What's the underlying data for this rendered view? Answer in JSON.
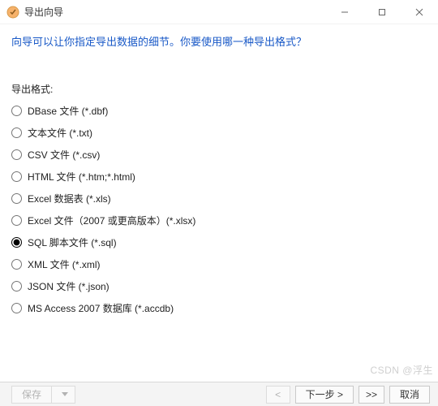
{
  "window": {
    "title": "导出向导",
    "minimize": "–",
    "maximize": "☐",
    "close": "×"
  },
  "instruction": "向导可以让你指定导出数据的细节。你要使用哪一种导出格式？",
  "section_label": "导出格式:",
  "selected_index": 6,
  "formats": [
    {
      "label": "DBase 文件 (*.dbf)"
    },
    {
      "label": "文本文件 (*.txt)"
    },
    {
      "label": "CSV 文件 (*.csv)"
    },
    {
      "label": "HTML 文件 (*.htm;*.html)"
    },
    {
      "label": "Excel 数据表 (*.xls)"
    },
    {
      "label": "Excel 文件（2007 或更高版本）(*.xlsx)"
    },
    {
      "label": "SQL 脚本文件 (*.sql)"
    },
    {
      "label": "XML 文件 (*.xml)"
    },
    {
      "label": "JSON 文件 (*.json)"
    },
    {
      "label": "MS Access 2007 数据库 (*.accdb)"
    }
  ],
  "footer": {
    "save": "保存",
    "back": "<",
    "next": "下一步 >",
    "last": ">>",
    "cancel": "取消"
  },
  "watermark": "CSDN @浮生"
}
